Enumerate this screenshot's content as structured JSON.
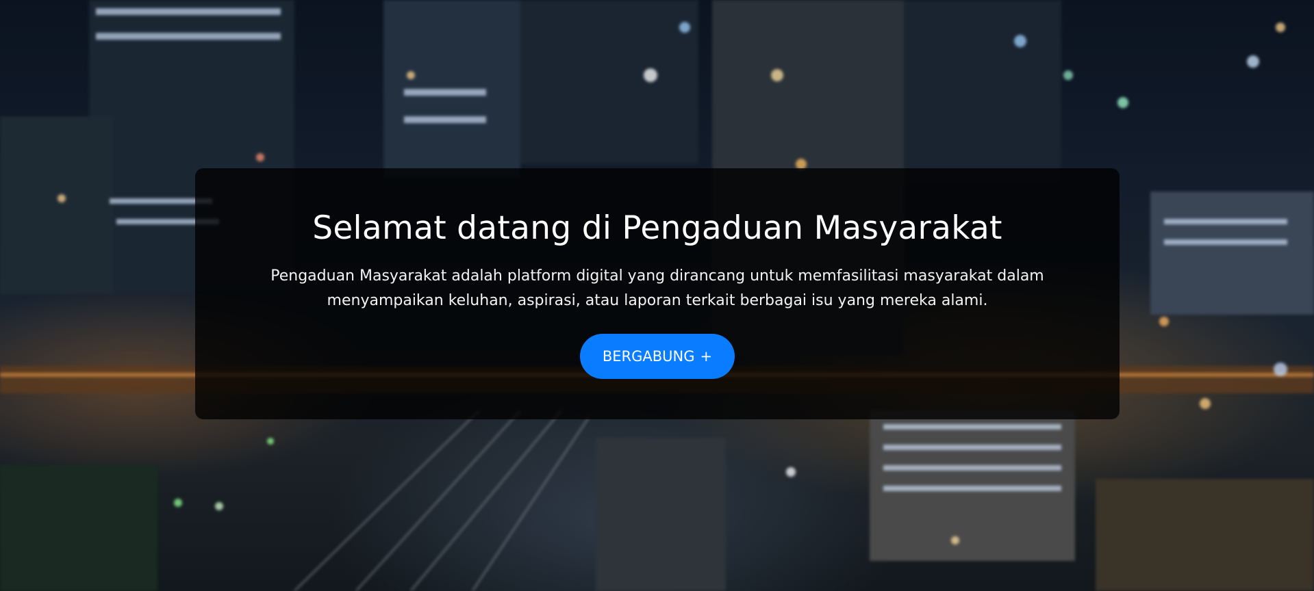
{
  "hero": {
    "title": "Selamat datang di Pengaduan Masyarakat",
    "description": "Pengaduan Masyarakat adalah platform digital yang dirancang untuk memfasilitasi masyarakat dalam menyampaikan keluhan, aspirasi, atau laporan terkait berbagai isu yang mereka alami.",
    "join_label": "BERGABUNG",
    "join_icon": "+",
    "button_color": "#0a7cff",
    "background": "blurred night city skyline photo"
  }
}
